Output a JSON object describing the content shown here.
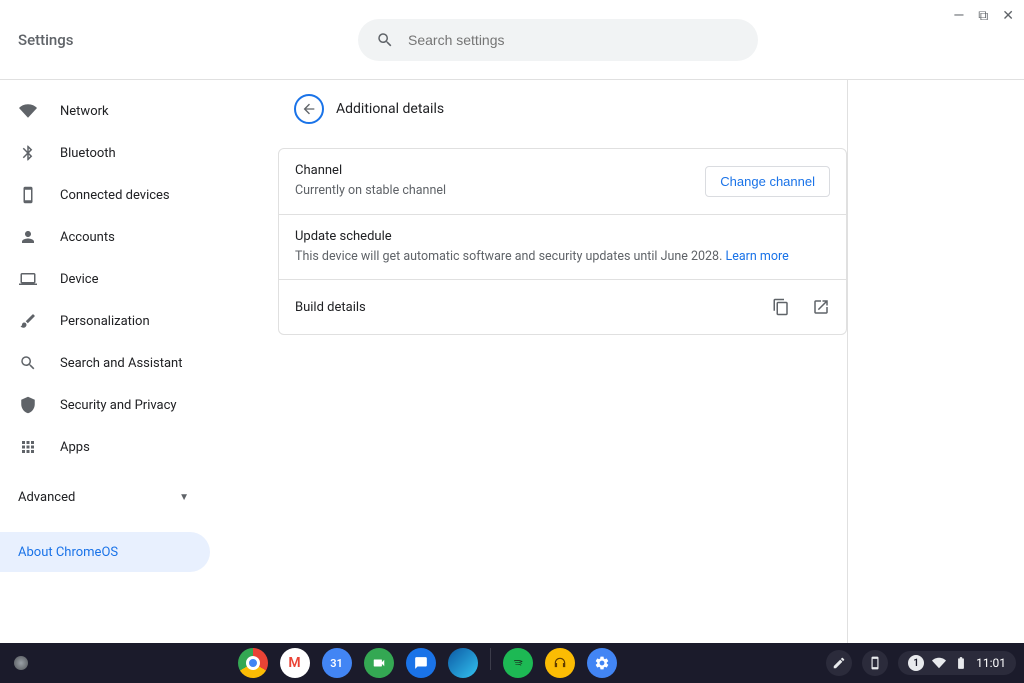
{
  "window": {
    "minimize": "—",
    "maximize": "❐",
    "close": "✕"
  },
  "header": {
    "app_title": "Settings",
    "search_placeholder": "Search settings"
  },
  "sidebar": {
    "items": [
      {
        "label": "Network"
      },
      {
        "label": "Bluetooth"
      },
      {
        "label": "Connected devices"
      },
      {
        "label": "Accounts"
      },
      {
        "label": "Device"
      },
      {
        "label": "Personalization"
      },
      {
        "label": "Search and Assistant"
      },
      {
        "label": "Security and Privacy"
      },
      {
        "label": "Apps"
      }
    ],
    "advanced_label": "Advanced",
    "about_label": "About ChromeOS"
  },
  "main": {
    "page_title": "Additional details",
    "channel": {
      "title": "Channel",
      "sub": "Currently on stable channel",
      "button": "Change channel"
    },
    "update": {
      "title": "Update schedule",
      "sub_prefix": "This device will get automatic software and security updates until June 2028. ",
      "learn_more": "Learn more"
    },
    "build": {
      "title": "Build details"
    }
  },
  "shelf": {
    "time": "11:01",
    "notif_count": "1"
  }
}
